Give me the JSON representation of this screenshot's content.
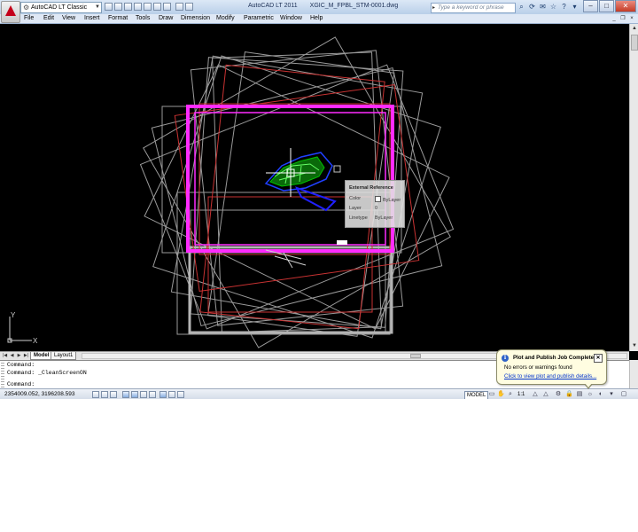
{
  "app": {
    "title": "AutoCAD LT 2011",
    "filename": "XGIC_M_FPBL_STM-0001.dwg",
    "workspace": "AutoCAD LT Classic",
    "search_placeholder": "Type a keyword or phrase"
  },
  "menu": [
    "File",
    "Edit",
    "View",
    "Insert",
    "Format",
    "Tools",
    "Draw",
    "Dimension",
    "Modify",
    "Parametric",
    "Window",
    "Help"
  ],
  "tooltip": {
    "title": "External Reference",
    "rows": [
      {
        "key": "Color",
        "value": "ByLayer"
      },
      {
        "key": "Layer",
        "value": "0"
      },
      {
        "key": "Linetype",
        "value": "ByLayer"
      }
    ]
  },
  "ucs": {
    "x_label": "X",
    "y_label": "Y"
  },
  "tabs": [
    "Model",
    "Layout1"
  ],
  "command_lines": [
    "Command:",
    "Command: _CleanScreenON",
    "Command:"
  ],
  "status": {
    "coordinates": "2354009.052, 3196208.593",
    "model": "MODEL",
    "scale": "1:1"
  },
  "notification": {
    "title": "Plot and Publish Job Complete",
    "message": "No errors or warnings found",
    "link": "Click to view plot and publish details..."
  },
  "colors": {
    "drawing_bg": "#000000",
    "magenta": "#ff2bff",
    "red": "#c83232",
    "blue": "#2040ff",
    "green": "#00c000"
  }
}
